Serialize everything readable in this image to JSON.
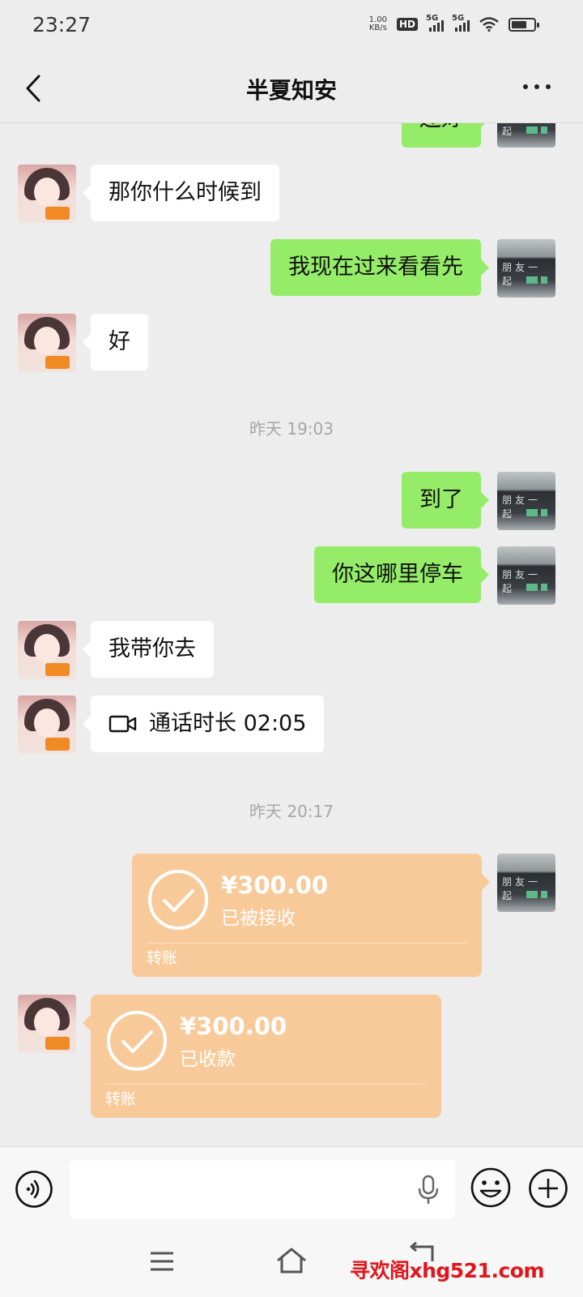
{
  "status_bar": {
    "time": "23:27",
    "net_speed_value": "1.00",
    "net_speed_unit": "KB/s",
    "hd_label": "HD",
    "sim1_label": "5G",
    "sim2_label": "5G",
    "battery_level": 0.7
  },
  "header": {
    "title": "半夏知安"
  },
  "messages": {
    "partial_top": {
      "text": "还好",
      "side": "right"
    },
    "m1": {
      "text": "那你什么时候到",
      "side": "left"
    },
    "m2": {
      "text": "我现在过来看看先",
      "side": "right"
    },
    "m3": {
      "text": "好",
      "side": "left"
    },
    "ts1": "昨天 19:03",
    "m4": {
      "text": "到了",
      "side": "right"
    },
    "m5": {
      "text": "你这哪里停车",
      "side": "right"
    },
    "m6": {
      "text": "我带你去",
      "side": "left"
    },
    "m7": {
      "text": "通话时长 02:05",
      "side": "left",
      "icon": "video-call-icon"
    },
    "ts2": "昨天 20:17",
    "t1": {
      "amount": "¥300.00",
      "status": "已被接收",
      "kind": "转账",
      "side": "right"
    },
    "t2": {
      "amount": "¥300.00",
      "status": "已收款",
      "kind": "转账",
      "side": "left"
    }
  },
  "avatar_shop_sign": "朋友一起",
  "input_bar": {
    "placeholder": ""
  },
  "nav_bar": {
    "watermark": "寻欢阁xhg521.com"
  },
  "colors": {
    "background": "#ededed",
    "bubble_self": "#95ec69",
    "bubble_other": "#ffffff",
    "transfer": "#f8ca9a",
    "timestamp": "#a6a6a6",
    "watermark": "#e0161d"
  }
}
